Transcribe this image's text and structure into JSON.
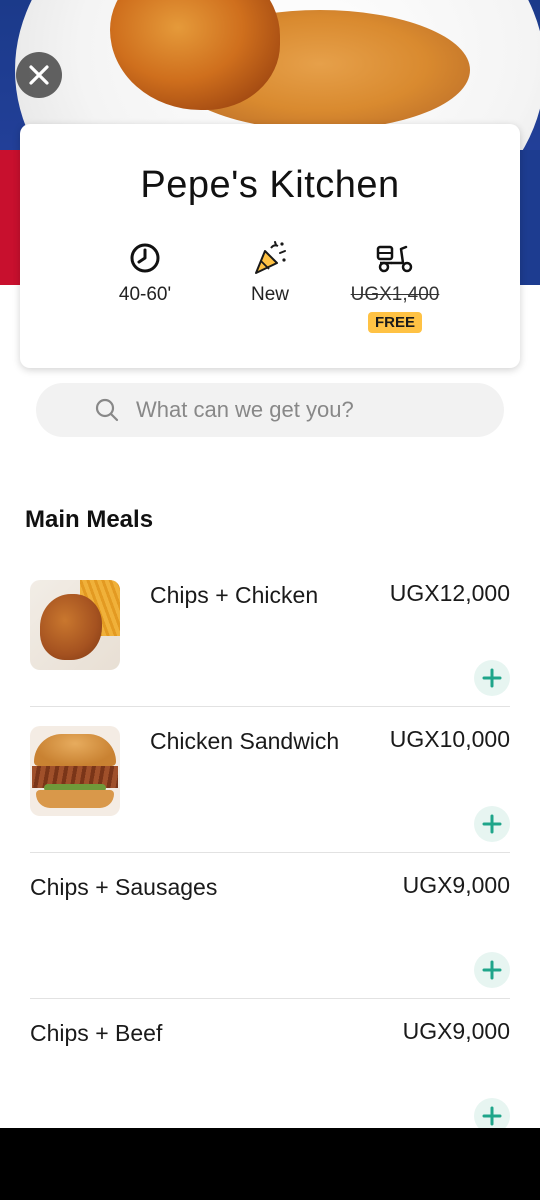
{
  "store": {
    "name": "Pepe's Kitchen",
    "delivery_time": "40-60'",
    "status": "New",
    "delivery_fee_old": "UGX1,400",
    "delivery_fee_badge": "FREE"
  },
  "search": {
    "placeholder": "What can we get you?"
  },
  "section": {
    "title": "Main Meals",
    "items": [
      {
        "name": "Chips + Chicken",
        "price": "UGX12,000",
        "image": "chips-chicken"
      },
      {
        "name": "Chicken Sandwich",
        "price": "UGX10,000",
        "image": "chicken-sandwich"
      },
      {
        "name": "Chips + Sausages",
        "price": "UGX9,000"
      },
      {
        "name": "Chips + Beef",
        "price": "UGX9,000"
      }
    ]
  },
  "colors": {
    "badge": "#ffc244",
    "add_button_bg": "#e7f5f1",
    "add_button_icon": "#1fa58a"
  },
  "icons": {
    "close": "close-icon",
    "time": "clock-icon",
    "new": "party-popper-icon",
    "delivery": "scooter-icon",
    "search": "search-icon",
    "add": "plus-icon"
  }
}
